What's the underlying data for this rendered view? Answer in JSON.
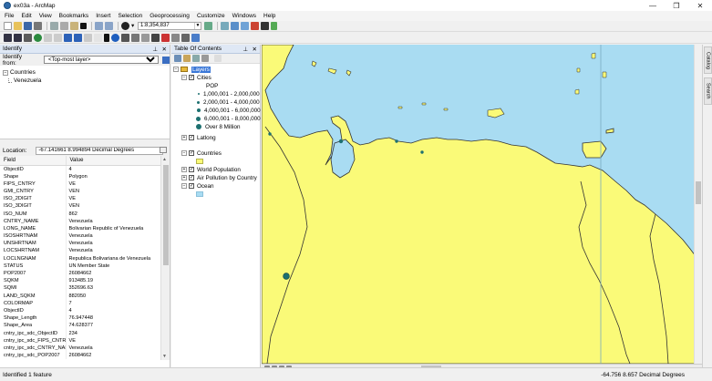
{
  "window": {
    "title": "ex03a - ArcMap"
  },
  "menu": [
    "File",
    "Edit",
    "View",
    "Bookmarks",
    "Insert",
    "Selection",
    "Geoprocessing",
    "Customize",
    "Windows",
    "Help"
  ],
  "toolbar": {
    "scale": "1:8,354,837"
  },
  "identify": {
    "panel_title": "Identify",
    "identify_from_label": "Identify from:",
    "identify_from_value": "<Top-most layer>",
    "tree_layer": "Countries",
    "tree_feature": "Venezuela",
    "location_label": "Location:",
    "location_value": "-67.141661  8.994894 Decimal Degrees",
    "columns": [
      "Field",
      "Value"
    ],
    "rows": [
      [
        "ObjectID",
        "4"
      ],
      [
        "Shape",
        "Polygon"
      ],
      [
        "FIPS_CNTRY",
        "VE"
      ],
      [
        "GMI_CNTRY",
        "VEN"
      ],
      [
        "ISO_2DIGIT",
        "VE"
      ],
      [
        "ISO_3DIGIT",
        "VEN"
      ],
      [
        "ISO_NUM",
        "862"
      ],
      [
        "CNTRY_NAME",
        "Venezuela"
      ],
      [
        "LONG_NAME",
        "Bolivarian Republic of Venezuela"
      ],
      [
        "ISOSHRTNAM",
        "Venezuela"
      ],
      [
        "UNSHRTNAM",
        "Venezuela"
      ],
      [
        "LOCSHRTNAM",
        "Venezuela"
      ],
      [
        "LOCLNGNAM",
        "Republica Bolivariana de Venezuela"
      ],
      [
        "STATUS",
        "UN Member State"
      ],
      [
        "POP2007",
        "26084662"
      ],
      [
        "SQKM",
        "913485.19"
      ],
      [
        "SQMI",
        "352696.63"
      ],
      [
        "LAND_SQKM",
        "882050"
      ],
      [
        "COLORMAP",
        "7"
      ],
      [
        "ObjectID",
        "4"
      ],
      [
        "Shape_Length",
        "76.947448"
      ],
      [
        "Shape_Area",
        "74.628377"
      ],
      [
        "cntry_ipc_sdc_ObjectID",
        "234"
      ],
      [
        "cntry_ipc_sdc_FIPS_CNTRY",
        "VE"
      ],
      [
        "cntry_ipc_sdc_CNTRY_NAME",
        "Venezuela"
      ],
      [
        "cntry_ipc_sdc_POP2007",
        "26084662"
      ]
    ]
  },
  "toc": {
    "panel_title": "Table Of Contents",
    "layers_label": "Layers",
    "cities_label": "Cities",
    "pop_label": "POP",
    "legend": [
      {
        "label": "1,000,001 - 2,000,000",
        "size": 2
      },
      {
        "label": "2,000,001 - 4,000,000",
        "size": 3
      },
      {
        "label": "4,000,001 - 6,000,000",
        "size": 4
      },
      {
        "label": "6,000,001 - 8,000,000",
        "size": 5
      },
      {
        "label": "Over 8 Million",
        "size": 6
      }
    ],
    "latlong_label": "Latlong",
    "countries_label": "Countries",
    "world_population_label": "World Population",
    "air_pollution_label": "Air Pollution by Country",
    "ocean_label": "Ocean"
  },
  "side_tabs": [
    "Catalog",
    "Search"
  ],
  "status": {
    "left": "Identified 1 feature",
    "right": "-64.756  8.657 Decimal Degrees"
  },
  "colors": {
    "ocean": "#a9dcf2",
    "land": "#fafa78",
    "cities": "#1d7070",
    "coast": "#333333"
  }
}
